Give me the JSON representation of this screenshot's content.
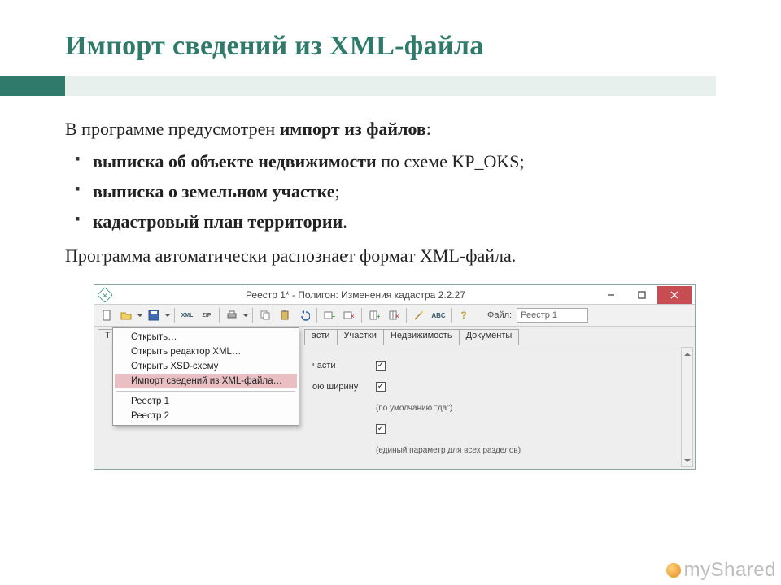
{
  "slide": {
    "title": "Импорт сведений из XML-файла",
    "intro_prefix": "В программе предусмотрен ",
    "intro_bold": "импорт из файлов",
    "intro_suffix": ":",
    "bullets": [
      {
        "bold": "выписка об объекте недвижимости",
        "rest": " по схеме KP_OKS;"
      },
      {
        "bold": "выписка о земельном участке",
        "rest": ";"
      },
      {
        "bold": "кадастровый план территории",
        "rest": "."
      }
    ],
    "outro": "Программа автоматически распознает формат XML-файла."
  },
  "app": {
    "title": "Реестр 1* - Полигон: Изменения кадастра 2.2.27",
    "file_label": "Файл:",
    "file_value": "Реестр 1",
    "toolbar": {
      "new": "new",
      "open": "open",
      "save": "save",
      "xml": "XML",
      "zip": "ZIP",
      "print": "print",
      "copy": "copy",
      "paste": "paste",
      "undo": "undo",
      "addrow": "addrow",
      "delrow": "delrow",
      "addcol": "addcol",
      "delcol": "delcol",
      "wand": "wand",
      "abc": "ABC",
      "help": "?"
    },
    "tabs": {
      "t1": "Т",
      "areas": "асти",
      "plots": "Участки",
      "realty": "Недвижимость",
      "docs": "Документы"
    },
    "dropdown": {
      "open": "Открыть…",
      "open_xml_editor": "Открыть редактор XML…",
      "open_xsd": "Открыть XSD-схему",
      "import_xml": "Импорт сведений из XML-файла…",
      "reestr1": "Реестр 1",
      "reestr2": "Реестр 2"
    },
    "rows": {
      "r1_label": "части",
      "r2_label": "ою ширину",
      "hint1": "(по умолчанию ''да'')",
      "hint2": "(единый параметр для всех разделов)"
    }
  },
  "watermark": "myShared"
}
